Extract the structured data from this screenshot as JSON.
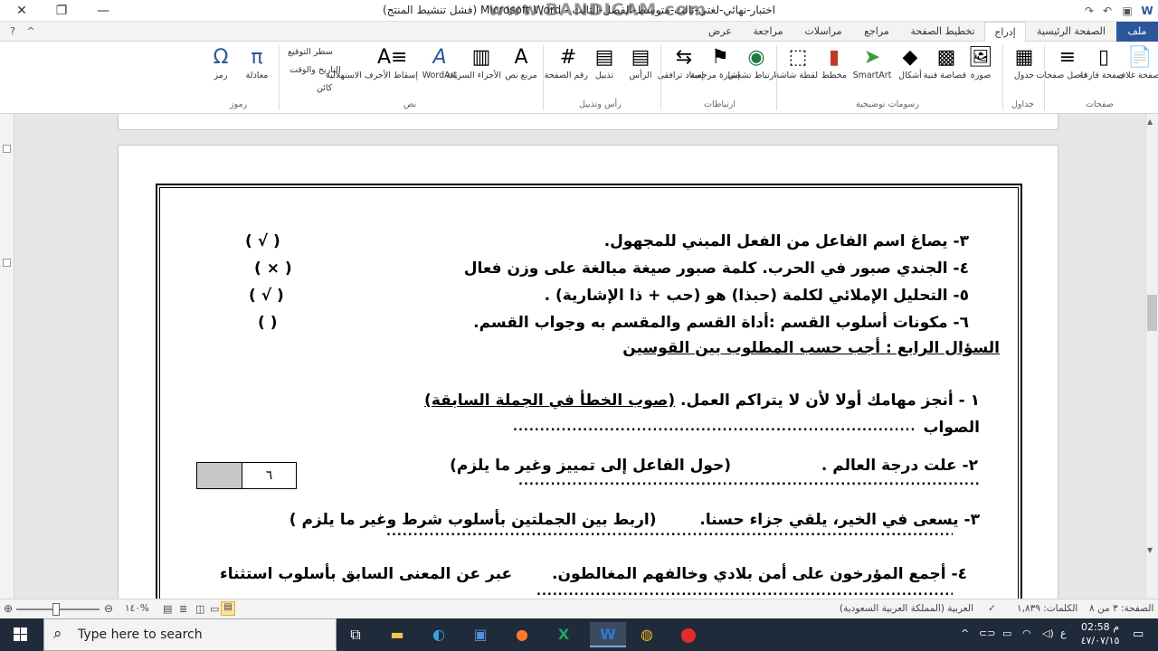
{
  "window": {
    "title": "اختبار-نهائي-لغتي-ثالث-متوسط-الفصل-الثالث - Microsoft Word (فشل تنشيط المنتج)",
    "watermark": "www.BANDICAM.com",
    "controls": {
      "close": "✕",
      "restore": "❐",
      "minimize": "—"
    }
  },
  "tabs": [
    "ملف",
    "الصفحة الرئيسية",
    "إدراج",
    "تخطيط الصفحة",
    "مراجع",
    "مراسلات",
    "مراجعة",
    "عرض"
  ],
  "active_tab": "إدراج",
  "ribbon": {
    "groups": [
      {
        "label": "صفحات",
        "buttons": [
          "صفحة غلاف",
          "صفحة فارغة",
          "فاصل صفحات"
        ]
      },
      {
        "label": "جداول",
        "buttons": [
          "جدول"
        ]
      },
      {
        "label": "رسومات توضيحية",
        "buttons": [
          "صورة",
          "قصاصة فنية",
          "أشكال",
          "SmartArt",
          "مخطط",
          "لقطة شاشة"
        ]
      },
      {
        "label": "ارتباطات",
        "buttons": [
          "ارتباط تشعبي",
          "إشارة مرجعية",
          "إسناد ترافقي"
        ]
      },
      {
        "label": "رأس وتذييل",
        "buttons": [
          "الرأس",
          "تذييل",
          "رقم الصفحة"
        ]
      },
      {
        "label": "نص",
        "buttons": [
          "مربع نص",
          "الأجزاء السريعة",
          "WordArt",
          "إسقاط الأحرف الاستهلالية"
        ]
      },
      {
        "label": "رموز",
        "buttons": [
          "معادلة",
          "رمز"
        ]
      }
    ],
    "text_small": [
      "سطر التوقيع",
      "التاريخ والوقت",
      "كائن"
    ]
  },
  "document": {
    "lines": [
      "٣- يصاغ اسم الفاعل من الفعل المبني للمجهول.",
      "٤- الجندي صبور في الحرب. كلمة صبور صيغة مبالغة على وزن فعال",
      "٥- التحليل الإملائي لكلمة (حبذا) هو (حب + ذا الإشارية) .",
      "٦- مكونات أسلوب القسم :أداة القسم والمقسم به وجواب القسم."
    ],
    "marks": [
      "( √ )",
      "( × )",
      "( √ )",
      "(    )"
    ],
    "section_title": "السؤال الرابع : أجب حسب المطلوب بين القوسين",
    "q1": "١ - أنجز مهامك أولا لأن لا يتراكم العمل.",
    "q1_instruction": "(صوب الخطأ في الجملة السابقة)",
    "q1_answer_label": "الصواب",
    "q2": "٢- علت درجة العالم .",
    "q2_instruction": "(حول الفاعل إلى تمييز وغير ما يلزم)",
    "q3": "٣- يسعى في الخير، يلقي جزاء حسنا.",
    "q3_instruction": "(اربط بين الجملتين بأسلوب شرط وغير ما يلزم )",
    "q4": "٤- أجمع المؤرخون على أمن بلادي وخالفهم المغالطون.",
    "q4_instruction": "عبر عن المعنى السابق بأسلوب استثناء",
    "score_box": "٦"
  },
  "status": {
    "page": "الصفحة: ٣ من ٨",
    "words": "الكلمات: ١,٨٣٩",
    "language": "العربية (المملكة العربية السعودية)",
    "zoom": "١٤٠%"
  },
  "taskbar": {
    "search_placeholder": "Type here to search",
    "time": "02:58 م",
    "date": "٤٧/٠٧/١٥",
    "lang": "ع"
  }
}
